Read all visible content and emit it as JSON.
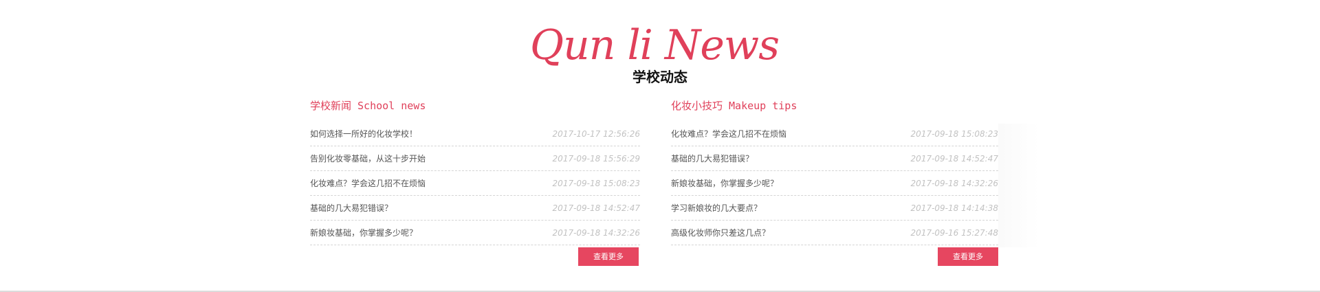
{
  "hero": {
    "title": "Qun li News",
    "subtitle": "学校动态"
  },
  "school_news": {
    "title": "学校新闻 School news",
    "items": [
      {
        "title": "如何选择一所好的化妆学校！",
        "date": "2017-10-17 12:56:26"
      },
      {
        "title": "告别化妆零基础，从这十步开始",
        "date": "2017-09-18 15:56:29"
      },
      {
        "title": "化妆难点？学会这几招不在烦恼",
        "date": "2017-09-18 15:08:23"
      },
      {
        "title": "基础的几大易犯错误？",
        "date": "2017-09-18 14:52:47"
      },
      {
        "title": "新娘妆基础，你掌握多少呢？",
        "date": "2017-09-18 14:32:26"
      }
    ],
    "more_label": "查看更多"
  },
  "makeup_tips": {
    "title": "化妆小技巧 Makeup tips",
    "items": [
      {
        "title": "化妆难点？学会这几招不在烦恼",
        "date": "2017-09-18 15:08:23"
      },
      {
        "title": "基础的几大易犯错误？",
        "date": "2017-09-18 14:52:47"
      },
      {
        "title": "新娘妆基础，你掌握多少呢？",
        "date": "2017-09-18 14:32:26"
      },
      {
        "title": "学习新娘妆的几大要点？",
        "date": "2017-09-18 14:14:38"
      },
      {
        "title": "高级化妆师你只差这几点？",
        "date": "2017-09-16 15:27:48"
      }
    ],
    "more_label": "查看更多"
  },
  "colors": {
    "accent": "#e64660",
    "title": "#e0405a",
    "text": "#555555",
    "date": "#c2c2c2"
  }
}
